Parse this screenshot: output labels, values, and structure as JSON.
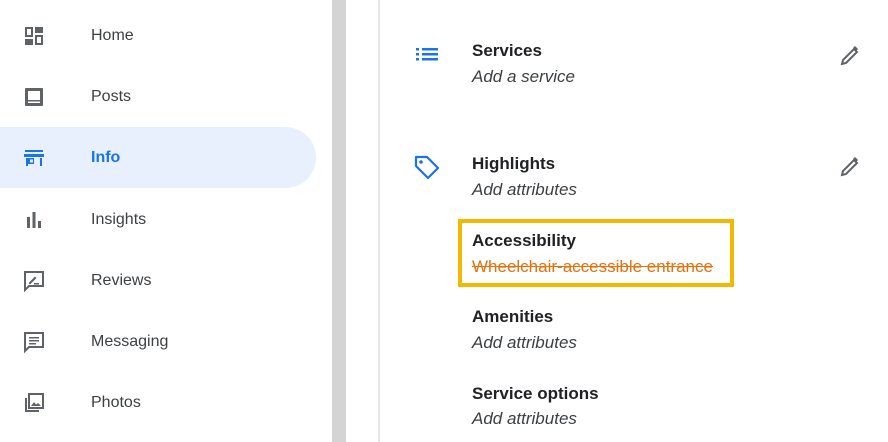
{
  "sidebar": {
    "items": [
      {
        "label": "Home",
        "icon": "dashboard-icon"
      },
      {
        "label": "Posts",
        "icon": "posts-icon"
      },
      {
        "label": "Info",
        "icon": "store-icon",
        "active": true
      },
      {
        "label": "Insights",
        "icon": "bar-chart-icon"
      },
      {
        "label": "Reviews",
        "icon": "rate-review-icon"
      },
      {
        "label": "Messaging",
        "icon": "message-icon"
      },
      {
        "label": "Photos",
        "icon": "photo-library-icon"
      }
    ]
  },
  "main": {
    "services": {
      "title": "Services",
      "subtitle": "Add a service"
    },
    "highlights": {
      "title": "Highlights",
      "subtitle": "Add attributes"
    },
    "accessibility": {
      "title": "Accessibility",
      "value": "Wheelchair-accessible entrance"
    },
    "amenities": {
      "title": "Amenities",
      "subtitle": "Add attributes"
    },
    "service_options": {
      "title": "Service options",
      "subtitle": "Add attributes"
    }
  },
  "colors": {
    "accent_blue": "#1a73e8",
    "active_bg": "#e8f0fe",
    "highlight_border": "#f5b800",
    "strike_orange": "#e8710a"
  }
}
